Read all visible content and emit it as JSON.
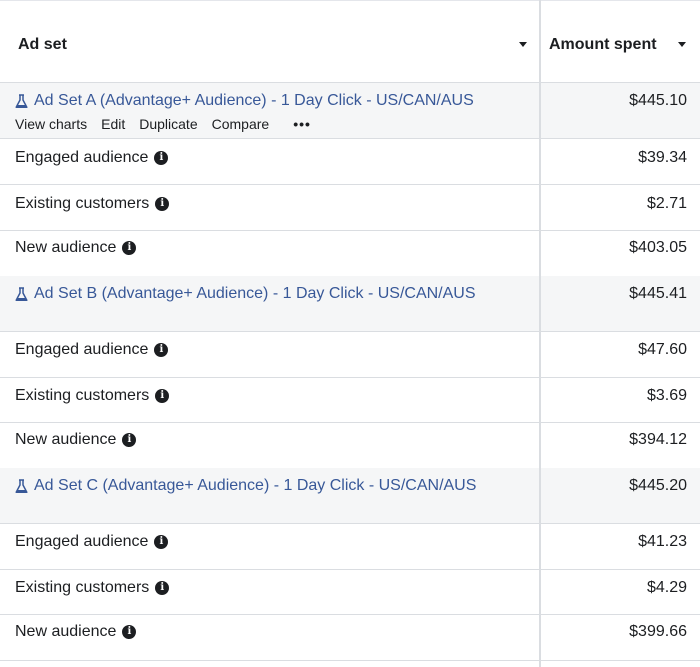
{
  "header": {
    "ad_set_label": "Ad set",
    "amount_label": "Amount spent"
  },
  "row_actions": {
    "view_charts": "View charts",
    "edit": "Edit",
    "duplicate": "Duplicate",
    "compare": "Compare",
    "more": "•••"
  },
  "groups": [
    {
      "name": "Ad Set A (Advantage+ Audience) - 1 Day Click - US/CAN/AUS",
      "amount": "$445.10",
      "segments": [
        {
          "name": "Engaged audience",
          "amount": "$39.34"
        },
        {
          "name": "Existing customers",
          "amount": "$2.71"
        },
        {
          "name": "New audience",
          "amount": "$403.05"
        }
      ]
    },
    {
      "name": "Ad Set B (Advantage+ Audience) - 1 Day Click - US/CAN/AUS",
      "amount": "$445.41",
      "segments": [
        {
          "name": "Engaged audience",
          "amount": "$47.60"
        },
        {
          "name": "Existing customers",
          "amount": "$3.69"
        },
        {
          "name": "New audience",
          "amount": "$394.12"
        }
      ]
    },
    {
      "name": "Ad Set C (Advantage+ Audience) - 1 Day Click - US/CAN/AUS",
      "amount": "$445.20",
      "segments": [
        {
          "name": "Engaged audience",
          "amount": "$41.23"
        },
        {
          "name": "Existing customers",
          "amount": "$4.29"
        },
        {
          "name": "New audience",
          "amount": "$399.66"
        }
      ]
    }
  ],
  "colors": {
    "link": "#385898",
    "group_bg": "#f5f6f7",
    "border": "#dadde1"
  },
  "icons": {
    "flask": "flask-icon",
    "info": "info-icon",
    "sort": "sort-caret-icon"
  }
}
